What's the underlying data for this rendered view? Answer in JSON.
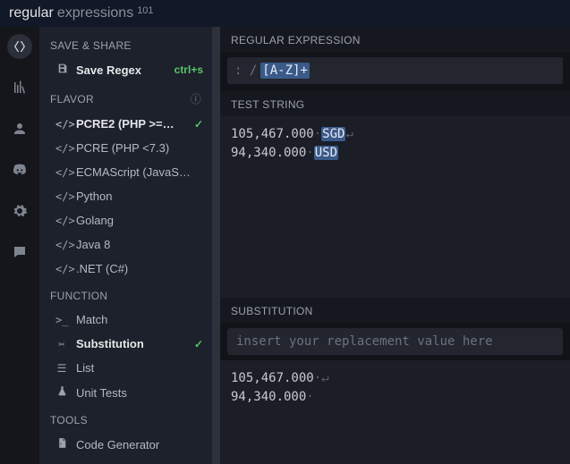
{
  "brand": {
    "prefix": "regular",
    "suffix": "expressions",
    "num": "101"
  },
  "sidebar": {
    "save_share": "SAVE & SHARE",
    "save_label": "Save Regex",
    "save_shortcut": "ctrl+s",
    "flavor": "FLAVOR",
    "flavors": [
      "PCRE2 (PHP >=…",
      "PCRE (PHP <7.3)",
      "ECMAScript (JavaS…",
      "Python",
      "Golang",
      "Java 8",
      ".NET (C#)"
    ],
    "function": "FUNCTION",
    "functions": [
      "Match",
      "Substitution",
      "List",
      "Unit Tests"
    ],
    "tools": "TOOLS",
    "tools_items": [
      "Code Generator"
    ]
  },
  "panes": {
    "regex": "REGULAR EXPRESSION",
    "test": "TEST STRING",
    "sub": "SUBSTITUTION"
  },
  "regex": {
    "open": ": /",
    "pattern": "[A-Z]+"
  },
  "test": {
    "l1_pre": "105,467.000",
    "l1_match": "SGD",
    "l2_pre": "94,340.000",
    "l2_match": "USD"
  },
  "sub": {
    "placeholder": "insert your replacement value here",
    "out1": "105,467.000",
    "out2": "94,340.000"
  }
}
